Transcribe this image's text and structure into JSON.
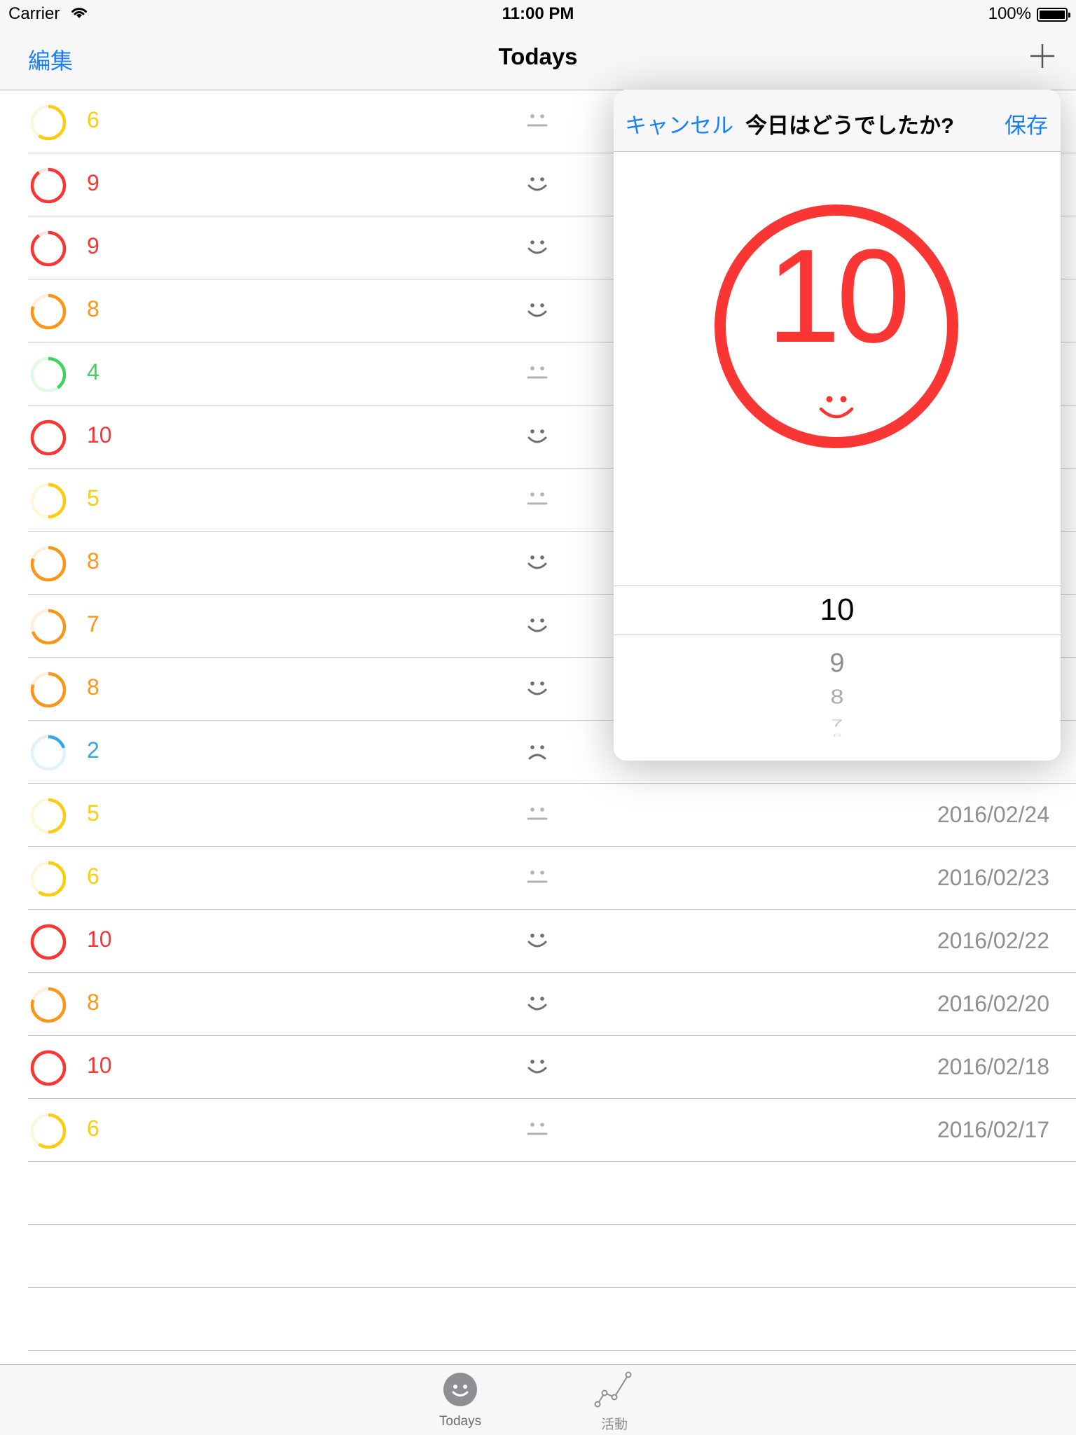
{
  "status_bar": {
    "carrier": "Carrier",
    "time": "11:00 PM",
    "battery": "100%"
  },
  "nav": {
    "edit_label": "編集",
    "title": "Todays",
    "add_icon": "plus-icon"
  },
  "colors": {
    "red": "#f93633",
    "orange": "#fc9518",
    "yellow": "#fecc0f",
    "green": "#3ed45b",
    "blue": "#33a8e2",
    "tint": "#1a7ff5"
  },
  "entries": [
    {
      "score": "6",
      "date": "",
      "mood": "neutral"
    },
    {
      "score": "9",
      "date": "",
      "mood": "happy"
    },
    {
      "score": "9",
      "date": "",
      "mood": "happy"
    },
    {
      "score": "8",
      "date": "",
      "mood": "happy"
    },
    {
      "score": "4",
      "date": "",
      "mood": "neutral"
    },
    {
      "score": "10",
      "date": "",
      "mood": "happy"
    },
    {
      "score": "5",
      "date": "",
      "mood": "neutral"
    },
    {
      "score": "8",
      "date": "",
      "mood": "happy"
    },
    {
      "score": "7",
      "date": "",
      "mood": "happy"
    },
    {
      "score": "8",
      "date": "",
      "mood": "happy"
    },
    {
      "score": "2",
      "date": "",
      "mood": "sad"
    },
    {
      "score": "5",
      "date": "2016/02/24",
      "mood": "neutral"
    },
    {
      "score": "6",
      "date": "2016/02/23",
      "mood": "neutral"
    },
    {
      "score": "10",
      "date": "2016/02/22",
      "mood": "happy"
    },
    {
      "score": "8",
      "date": "2016/02/20",
      "mood": "happy"
    },
    {
      "score": "10",
      "date": "2016/02/18",
      "mood": "happy"
    },
    {
      "score": "6",
      "date": "2016/02/17",
      "mood": "neutral"
    }
  ],
  "popover": {
    "cancel_label": "キャンセル",
    "title": "今日はどうでしたか?",
    "save_label": "保存",
    "current_value": "10",
    "current_mood": "happy",
    "picker_values": [
      "10",
      "9",
      "8",
      "7",
      "6"
    ]
  },
  "tabs": [
    {
      "label": "Todays",
      "icon": "smiley-icon",
      "selected": true
    },
    {
      "label": "活動",
      "icon": "activity-chart-icon",
      "selected": false
    }
  ]
}
